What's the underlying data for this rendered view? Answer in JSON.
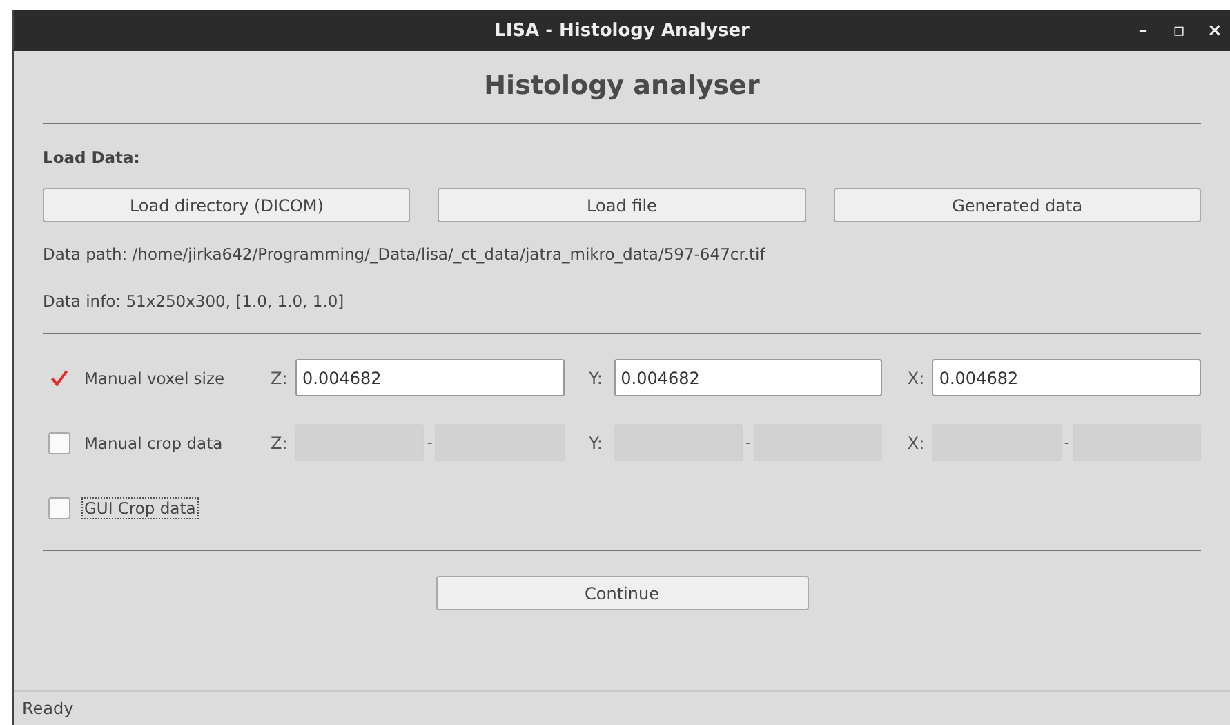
{
  "window": {
    "title": "LISA - Histology Analyser",
    "controls": [
      "–",
      "▫",
      "×"
    ]
  },
  "heading": "Histology analyser",
  "load_section": {
    "label": "Load Data:",
    "buttons": [
      "Load directory (DICOM)",
      "Load file",
      "Generated data"
    ]
  },
  "data_path": "Data path: /home/jirka642/Programming/_Data/lisa/_ct_data/jatra_mikro_data/597-647cr.tif",
  "data_info": "Data info: 51x250x300, [1.0, 1.0, 1.0]",
  "options": [
    {
      "kind": "single",
      "label": "Manual voxel size",
      "checked": true,
      "focused": false,
      "disabled": false,
      "axes": [
        {
          "label": "Z:",
          "values": [
            "0.004682"
          ]
        },
        {
          "label": "Y:",
          "values": [
            "0.004682"
          ]
        },
        {
          "label": "X:",
          "values": [
            "0.004682"
          ]
        }
      ]
    },
    {
      "kind": "range",
      "label": "Manual crop data",
      "checked": false,
      "focused": false,
      "disabled": true,
      "separator": "-",
      "axes": [
        {
          "label": "Z:"
        },
        {
          "label": "Y:"
        },
        {
          "label": "X:"
        }
      ]
    },
    {
      "kind": "plain",
      "label": "GUI Crop data",
      "checked": false,
      "focused": true
    }
  ],
  "continue_button": "Continue",
  "status_bar": "Ready"
}
